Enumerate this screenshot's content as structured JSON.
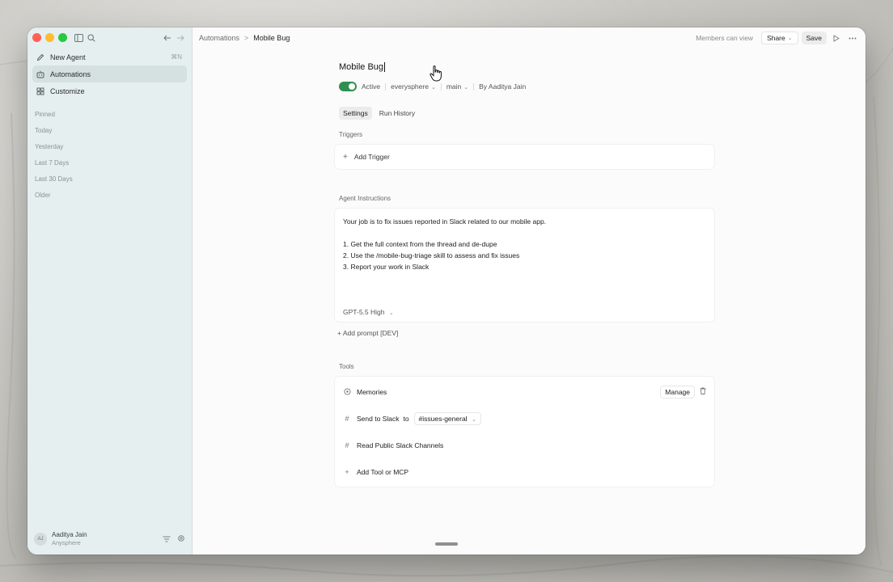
{
  "sidebar": {
    "items": [
      {
        "label": "New Agent",
        "shortcut": "⌘N"
      },
      {
        "label": "Automations"
      },
      {
        "label": "Customize"
      }
    ],
    "sections": [
      "Pinned",
      "Today",
      "Yesterday",
      "Last 7 Days",
      "Last 30 Days",
      "Older"
    ],
    "user": {
      "initials": "AJ",
      "name": "Aaditya Jain",
      "org": "Anysphere"
    }
  },
  "header": {
    "breadcrumb": [
      "Automations",
      "Mobile Bug"
    ],
    "visibility": "Members can view",
    "share_label": "Share",
    "save_label": "Save"
  },
  "agent": {
    "title": "Mobile Bug",
    "status": "Active",
    "repo": "everysphere",
    "branch": "main",
    "author": "By Aaditya Jain"
  },
  "tabs": [
    "Settings",
    "Run History"
  ],
  "triggers": {
    "label": "Triggers",
    "add_label": "Add Trigger"
  },
  "instructions": {
    "label": "Agent Instructions",
    "lines": [
      "Your job is to fix issues reported in Slack related to our mobile app.",
      "",
      "1. Get the full context from the thread and de-dupe",
      "2. Use the /mobile-bug-triage skill to assess and fix issues",
      "3. Report your work in Slack"
    ],
    "model": "GPT-5.5 High",
    "add_prompt": "Add prompt [DEV]"
  },
  "tools": {
    "label": "Tools",
    "memories": {
      "name": "Memories",
      "manage_label": "Manage"
    },
    "send_slack": {
      "name": "Send to Slack",
      "to": "to",
      "channel": "#issues-general"
    },
    "read_slack": {
      "name": "Read Public Slack Channels"
    },
    "add_label": "Add Tool or MCP"
  },
  "colors": {
    "accent_green": "#2f8f52",
    "sidebar_bg": "#e5efef"
  }
}
